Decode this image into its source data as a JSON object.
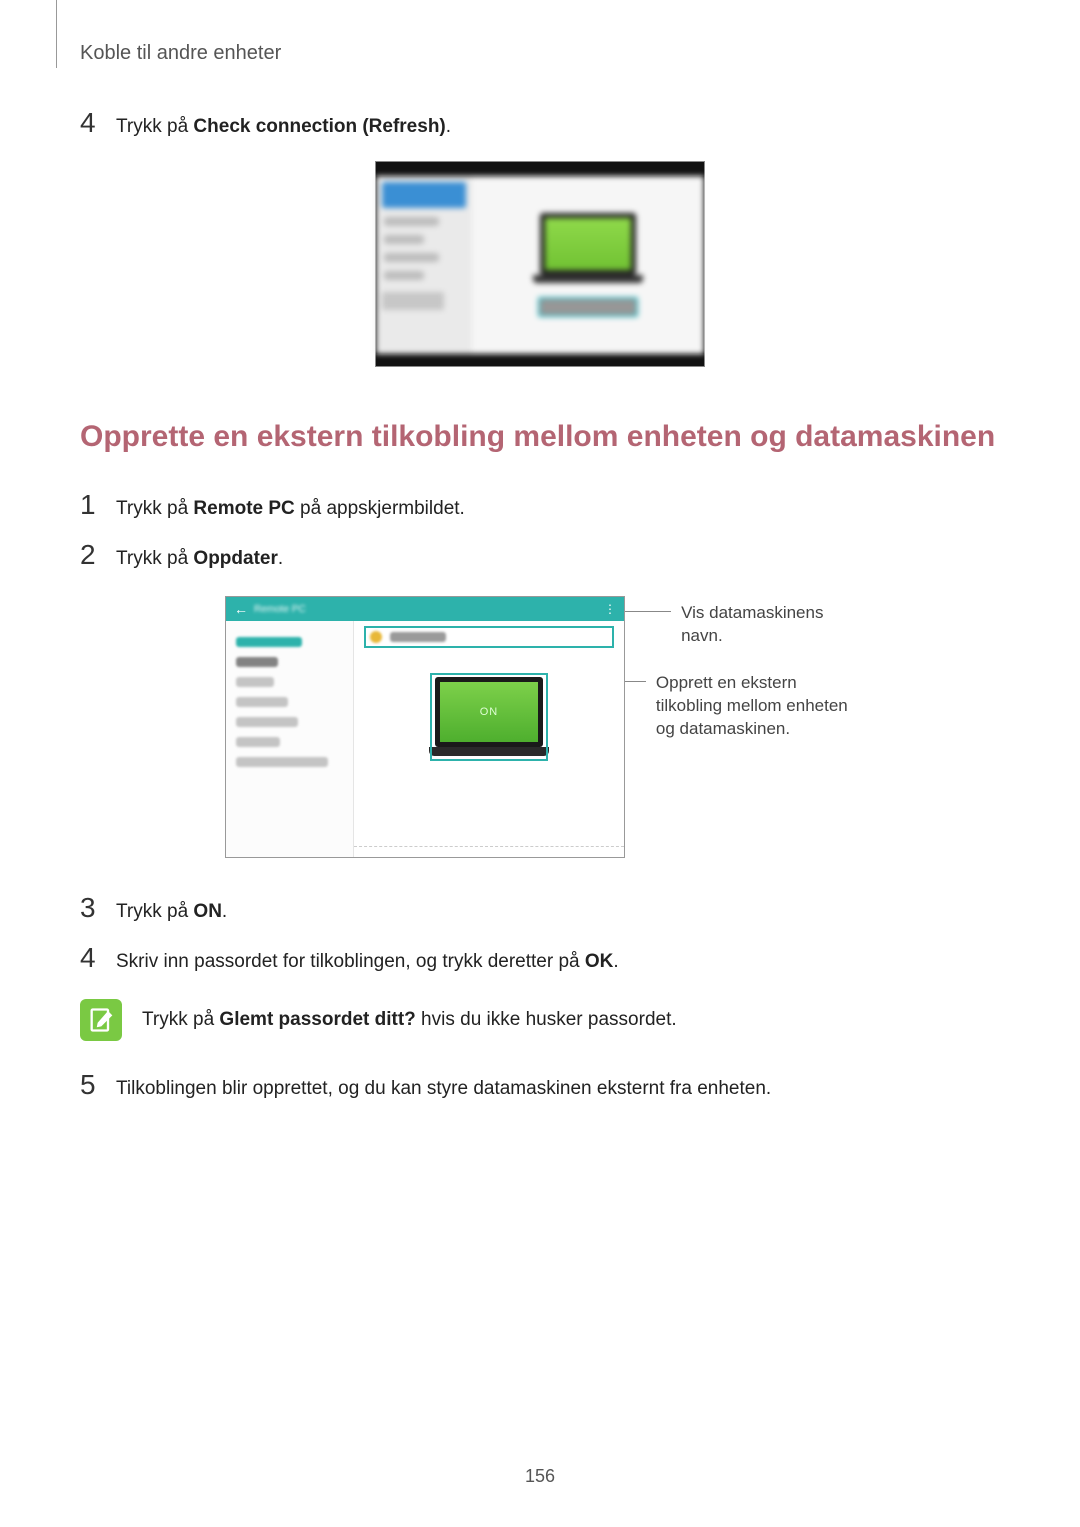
{
  "breadcrumb": "Koble til andre enheter",
  "step4a": {
    "num": "4",
    "pre": "Trykk på ",
    "bold": "Check connection (Refresh)",
    "post": "."
  },
  "section_heading": "Opprette en ekstern tilkobling mellom enheten og datamaskinen",
  "step1": {
    "num": "1",
    "pre": "Trykk på ",
    "bold": "Remote PC",
    "post": " på appskjermbildet."
  },
  "step2": {
    "num": "2",
    "pre": "Trykk på ",
    "bold": "Oppdater",
    "post": "."
  },
  "fig2": {
    "on_label": "ON"
  },
  "callout1": "Vis datamaskinens navn.",
  "callout2": "Opprett en ekstern tilkobling mellom enheten og datamaskinen.",
  "step3": {
    "num": "3",
    "pre": "Trykk på ",
    "bold": "ON",
    "post": "."
  },
  "step4b": {
    "num": "4",
    "pre": "Skriv inn passordet for tilkoblingen, og trykk deretter på ",
    "bold": "OK",
    "post": "."
  },
  "note": {
    "pre": "Trykk på ",
    "bold": "Glemt passordet ditt?",
    "post": " hvis du ikke husker passordet."
  },
  "step5": {
    "num": "5",
    "text": "Tilkoblingen blir opprettet, og du kan styre datamaskinen eksternt fra enheten."
  },
  "page_number": "156"
}
